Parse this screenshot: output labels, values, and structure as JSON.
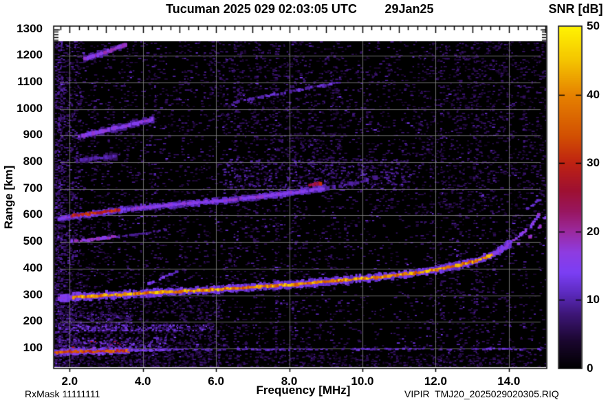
{
  "header": {
    "station_title": "Tucuman 2025 029 02:03:05 UTC",
    "date_label": "29Jan25"
  },
  "colorbar": {
    "label": "SNR [dB]",
    "min": 0,
    "max": 50,
    "tick_values": [
      0,
      10,
      20,
      30,
      40,
      50
    ],
    "tick_labels": [
      "0",
      "10",
      "20",
      "30",
      "40",
      "50"
    ],
    "gradient_stops": [
      [
        0,
        [
          0,
          0,
          0
        ]
      ],
      [
        4,
        [
          26,
          6,
          46
        ]
      ],
      [
        8,
        [
          62,
          22,
          120
        ]
      ],
      [
        11,
        [
          92,
          42,
          190
        ]
      ],
      [
        14,
        [
          123,
          62,
          244
        ]
      ],
      [
        17,
        [
          142,
          60,
          225
        ]
      ],
      [
        20,
        [
          155,
          42,
          160
        ]
      ],
      [
        23,
        [
          152,
          22,
          95
        ]
      ],
      [
        26,
        [
          158,
          16,
          50
        ]
      ],
      [
        30,
        [
          190,
          34,
          18
        ]
      ],
      [
        34,
        [
          210,
          80,
          2
        ]
      ],
      [
        40,
        [
          230,
          130,
          0
        ]
      ],
      [
        45,
        [
          244,
          196,
          0
        ]
      ],
      [
        50,
        [
          255,
          244,
          2
        ]
      ]
    ]
  },
  "axes": {
    "x": {
      "label": "Frequency [MHz]",
      "min": 1.6,
      "max": 15.0,
      "tick_values": [
        2,
        4,
        6,
        8,
        10,
        12,
        14
      ],
      "tick_labels": [
        "2.0",
        "4.0",
        "6.0",
        "8.0",
        "10.0",
        "12.0",
        "14.0"
      ],
      "minor_tick_step": 0.25
    },
    "y": {
      "label": "Range [km]",
      "min": 30,
      "max": 1310,
      "tick_values": [
        100,
        200,
        300,
        400,
        500,
        600,
        700,
        800,
        900,
        1000,
        1100,
        1200,
        1300
      ],
      "tick_labels": [
        "100",
        "200",
        "300",
        "400",
        "500",
        "600",
        "700",
        "800",
        "900",
        "1000",
        "1100",
        "1200",
        "1300"
      ],
      "minor_tick_step": 10
    }
  },
  "footer": {
    "rx_mask": "RxMask 11111111",
    "file_label": "VIPIR  TMJ20_2025029020305.RIQ"
  },
  "chart_data": {
    "type": "heatmap",
    "title": "Ionogram, Tucuman, 2025 day 029 02:03:05 UTC",
    "x_unit": "MHz",
    "y_unit": "km",
    "value_unit": "dB SNR",
    "xlim": [
      1.6,
      15.0
    ],
    "ylim": [
      30,
      1310
    ],
    "grid": {
      "x_step": 2,
      "y_step": 100,
      "color": "#828282"
    },
    "noise": {
      "base_density": 0.13,
      "v_range": [
        2.5,
        8.5
      ]
    },
    "rfi_columns": [
      [
        1.63,
        0.85
      ],
      [
        1.7,
        0.7
      ],
      [
        1.78,
        0.55
      ],
      [
        2.1,
        0.35
      ],
      [
        2.62,
        0.3
      ],
      [
        3.06,
        0.4
      ],
      [
        3.52,
        0.3
      ],
      [
        4.3,
        0.3
      ],
      [
        5.15,
        0.25
      ],
      [
        6.52,
        0.35
      ],
      [
        7.08,
        0.4
      ],
      [
        7.62,
        0.45
      ],
      [
        8.12,
        0.3
      ],
      [
        9.1,
        0.25
      ],
      [
        10.35,
        0.2
      ],
      [
        11.15,
        0.2
      ],
      [
        12.12,
        0.4
      ],
      [
        12.62,
        0.35
      ],
      [
        13.08,
        0.45
      ],
      [
        13.55,
        0.25
      ],
      [
        14.4,
        0.2
      ]
    ],
    "clouds": [
      {
        "name": "sporadic-e-cloud",
        "f": [
          1.7,
          4.6
        ],
        "r": [
          92,
          142
        ],
        "p": 0.4,
        "v": [
          6,
          16
        ]
      },
      {
        "name": "sporadic-e-hot-dots",
        "f": [
          2.0,
          3.5
        ],
        "r": [
          96,
          128
        ],
        "p": 0.07,
        "v": [
          20,
          30
        ]
      },
      {
        "name": "band-180km",
        "f": [
          1.7,
          5.9
        ],
        "r": [
          166,
          190
        ],
        "p": 0.45,
        "v": [
          7,
          15
        ]
      },
      {
        "name": "band-180km-bright",
        "f": [
          1.8,
          3.6
        ],
        "r": [
          170,
          186
        ],
        "p": 0.4,
        "v": [
          10,
          17
        ]
      },
      {
        "name": "cloud-210km",
        "f": [
          1.8,
          3.7
        ],
        "r": [
          192,
          240
        ],
        "p": 0.28,
        "v": [
          5,
          12
        ]
      },
      {
        "name": "second-hop-spread",
        "f": [
          6.2,
          11.3
        ],
        "r": [
          695,
          812
        ],
        "p": 0.2,
        "v": [
          4,
          12
        ]
      },
      {
        "name": "fuzz-850km",
        "f": [
          7.5,
          9.4
        ],
        "r": [
          798,
          902
        ],
        "p": 0.15,
        "v": [
          4,
          9
        ]
      },
      {
        "name": "upper-mid-speckle",
        "f": [
          5.8,
          9.6
        ],
        "r": [
          900,
          1290
        ],
        "p": 0.08,
        "v": [
          3,
          9
        ]
      },
      {
        "name": "upper-right-speckle",
        "f": [
          11.4,
          15.0
        ],
        "r": [
          600,
          1290
        ],
        "p": 0.07,
        "v": [
          3,
          8
        ]
      },
      {
        "name": "lower-left-dense",
        "f": [
          1.6,
          6.2
        ],
        "r": [
          30,
          320
        ],
        "p": 0.2,
        "v": [
          3,
          9
        ]
      },
      {
        "name": "left-edge-band",
        "f": [
          1.6,
          2.3
        ],
        "r": [
          30,
          1255
        ],
        "p": 0.22,
        "v": [
          3,
          10
        ]
      },
      {
        "name": "bottom-rows",
        "f": [
          1.6,
          15.0
        ],
        "r": [
          30,
          80
        ],
        "p": 0.18,
        "v": [
          3,
          8
        ]
      }
    ],
    "traces": [
      {
        "name": "e-region-echo",
        "pts": [
          [
            1.6,
            86
          ],
          [
            2.2,
            88
          ],
          [
            3.0,
            89
          ],
          [
            3.6,
            91
          ]
        ],
        "halo": {
          "v": 14,
          "w": 9
        },
        "core": {
          "v": 33,
          "w": 3.5
        },
        "dash": 0.02
      },
      {
        "name": "e-region-echo-fade",
        "pts": [
          [
            3.6,
            92
          ],
          [
            4.2,
            93
          ],
          [
            4.6,
            95
          ]
        ],
        "core": {
          "v": 14,
          "w": 3
        },
        "dash": 0.15
      },
      {
        "name": "e-region-flat-line",
        "pts": [
          [
            4.6,
            95
          ],
          [
            8.0,
            96
          ],
          [
            11.5,
            97
          ],
          [
            15.0,
            98
          ]
        ],
        "core": {
          "v": 11,
          "w": 2.5
        },
        "dash": 0.5
      },
      {
        "name": "f-region-main-trace",
        "pts": [
          [
            1.7,
            290
          ],
          [
            2.5,
            296
          ],
          [
            3.5,
            303
          ],
          [
            4.5,
            311
          ],
          [
            5.5,
            318
          ],
          [
            6.5,
            326
          ],
          [
            7.5,
            335
          ],
          [
            8.5,
            345
          ],
          [
            9.5,
            357
          ],
          [
            10.5,
            369
          ],
          [
            11.3,
            381
          ],
          [
            12.0,
            396
          ],
          [
            12.6,
            412
          ],
          [
            13.1,
            430
          ],
          [
            13.5,
            450
          ],
          [
            13.8,
            472
          ],
          [
            14.05,
            498
          ]
        ],
        "halo": {
          "v": 13,
          "w": 10
        },
        "core": {
          "v": 40,
          "w": 3.5
        },
        "dash": 0.03,
        "core_f": [
          2.1,
          13.55
        ]
      },
      {
        "name": "f-trace-branch-o",
        "pts": [
          [
            14.0,
            495
          ],
          [
            14.35,
            530
          ],
          [
            14.6,
            560
          ],
          [
            14.8,
            602
          ]
        ],
        "core": {
          "v": 17,
          "w": 4.5
        },
        "dash": 0.45
      },
      {
        "name": "f-trace-branch-x",
        "pts": [
          [
            14.25,
            492
          ],
          [
            14.6,
            524
          ],
          [
            14.85,
            558
          ],
          [
            15.0,
            596
          ]
        ],
        "core": {
          "v": 17,
          "w": 4.5
        },
        "dash": 0.45
      },
      {
        "name": "f-branch-upper-dots",
        "pts": [
          [
            14.5,
            626
          ],
          [
            14.7,
            646
          ],
          [
            14.9,
            668
          ]
        ],
        "core": {
          "v": 12,
          "w": 3.5
        },
        "dash": 0.5
      },
      {
        "name": "oblique-echo-segment",
        "pts": [
          [
            4.15,
            345
          ],
          [
            4.55,
            366
          ],
          [
            4.9,
            388
          ]
        ],
        "core": {
          "v": 13,
          "w": 3.5
        },
        "dash": 0.25
      },
      {
        "name": "half-hop-bright",
        "pts": [
          [
            2.05,
            502
          ],
          [
            2.7,
            512
          ],
          [
            3.3,
            521
          ]
        ],
        "core": {
          "v": 17,
          "w": 4
        },
        "dash": 0.08
      },
      {
        "name": "half-hop-faint",
        "pts": [
          [
            3.3,
            521
          ],
          [
            4.0,
            532
          ],
          [
            4.6,
            544
          ]
        ],
        "core": {
          "v": 9,
          "w": 3
        },
        "dash": 0.35
      },
      {
        "name": "second-hop-trace",
        "pts": [
          [
            1.7,
            588
          ],
          [
            2.5,
            603
          ],
          [
            3.35,
            620
          ],
          [
            4.2,
            632
          ],
          [
            5.0,
            642
          ],
          [
            6.0,
            654
          ],
          [
            7.0,
            668
          ],
          [
            8.0,
            684
          ],
          [
            9.0,
            702
          ]
        ],
        "halo": {
          "v": 11,
          "w": 8
        },
        "core": {
          "v": 16,
          "w": 3.5
        },
        "dash": 0.05
      },
      {
        "name": "second-hop-red-core",
        "pts": [
          [
            2.05,
            599
          ],
          [
            2.7,
            610
          ],
          [
            3.35,
            621
          ]
        ],
        "core": {
          "v": 29,
          "w": 3.5
        },
        "dash": 0.02
      },
      {
        "name": "second-hop-tail",
        "pts": [
          [
            9.0,
            702
          ],
          [
            9.8,
            722
          ],
          [
            10.4,
            742
          ]
        ],
        "core": {
          "v": 9,
          "w": 5
        },
        "dash": 0.4
      },
      {
        "name": "second-hop-red-spot",
        "pts": [
          [
            8.55,
            714
          ],
          [
            8.85,
            720
          ]
        ],
        "core": {
          "v": 27,
          "w": 4
        },
        "dash": 0
      },
      {
        "name": "spread-echo-800",
        "pts": [
          [
            2.2,
            806
          ],
          [
            2.7,
            815
          ],
          [
            3.25,
            823
          ]
        ],
        "halo": {
          "v": 7,
          "w": 9
        },
        "core": {
          "v": 10,
          "w": 4.5
        },
        "dash": 0.3
      },
      {
        "name": "second-hop-900",
        "pts": [
          [
            2.25,
            896
          ],
          [
            3.2,
            927
          ],
          [
            4.25,
            960
          ]
        ],
        "halo": {
          "v": 9,
          "w": 9
        },
        "core": {
          "v": 16,
          "w": 4.5
        },
        "dash": 0.05
      },
      {
        "name": "oblique-trace-1050",
        "pts": [
          [
            6.3,
            1020
          ],
          [
            7.4,
            1050
          ],
          [
            8.5,
            1078
          ],
          [
            9.35,
            1100
          ]
        ],
        "core": {
          "v": 11,
          "w": 4
        },
        "dash": 0.35
      },
      {
        "name": "top-left-trace-1200",
        "pts": [
          [
            2.4,
            1190
          ],
          [
            2.95,
            1213
          ],
          [
            3.5,
            1240
          ]
        ],
        "halo": {
          "v": 9,
          "w": 8
        },
        "core": {
          "v": 17,
          "w": 4.5
        },
        "dash": 0.05
      }
    ]
  }
}
